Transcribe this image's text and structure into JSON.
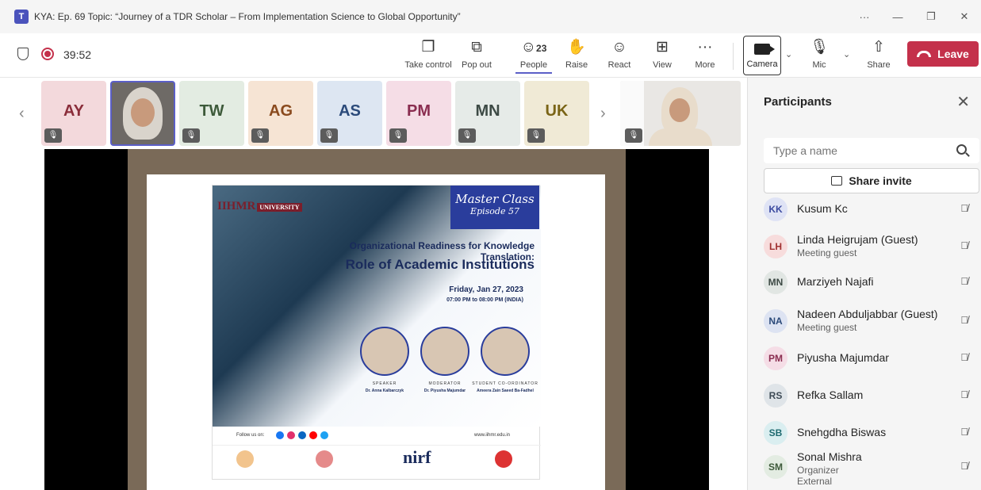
{
  "window": {
    "title": "KYA: Ep. 69 Topic: “Journey of a TDR Scholar – From Implementation Science to Global Opportunity”",
    "controls": [
      "···",
      "—",
      "❐",
      "✕"
    ]
  },
  "toolbar": {
    "timer": "39:52",
    "people_count": "23",
    "buttons": [
      {
        "label": "Take control",
        "icon": "take-control-icon",
        "glyph": "❐"
      },
      {
        "label": "Pop out",
        "icon": "pop-out-icon",
        "glyph": "⧉"
      },
      {
        "label": "People",
        "icon": "people-icon",
        "glyph": "☺"
      },
      {
        "label": "Raise",
        "icon": "raise-hand-icon",
        "glyph": "✋"
      },
      {
        "label": "React",
        "icon": "react-icon",
        "glyph": "☺"
      },
      {
        "label": "View",
        "icon": "view-icon",
        "glyph": "⊞"
      },
      {
        "label": "More",
        "icon": "more-icon",
        "glyph": "···"
      }
    ],
    "camera_label": "Camera",
    "mic_label": "Mic",
    "share_label": "Share",
    "leave_label": "Leave",
    "accent": "#5b5fc7",
    "leave_color": "#c4314b"
  },
  "video_strip": {
    "tiles": [
      {
        "initials": "AY",
        "color": "#f3d9dc",
        "text_color": "#8a2d3a"
      },
      {
        "initials": "",
        "video": true
      },
      {
        "initials": "TW",
        "color": "#e3ece2",
        "text_color": "#3d5a3a"
      },
      {
        "initials": "AG",
        "color": "#f6e4d4",
        "text_color": "#8a4a1e"
      },
      {
        "initials": "AS",
        "color": "#dde6f2",
        "text_color": "#2b4a7a"
      },
      {
        "initials": "PM",
        "color": "#f5dde6",
        "text_color": "#8a2d50"
      },
      {
        "initials": "MN",
        "color": "#e6ebe8",
        "text_color": "#3d4a45"
      },
      {
        "initials": "UK",
        "color": "#f0ead6",
        "text_color": "#7a6416"
      }
    ]
  },
  "shared_content": {
    "poster": {
      "logo": "IIHMR",
      "logo_tag": "UNIVERSITY",
      "masterclass_line1": "Master Class",
      "masterclass_line2": "Episode 57",
      "title_line1": "Organizational Readiness for Knowledge Translation:",
      "title_line2": "Role of Academic Institutions",
      "date": "Friday, Jan 27, 2023",
      "time": "07:00 PM to 08:00 PM (INDIA)",
      "speakers": [
        {
          "role": "SPEAKER",
          "name": "Dr. Anna Kalbarczyk"
        },
        {
          "role": "MODERATOR",
          "name": "Dr. Piyusha Majumdar"
        },
        {
          "role": "STUDENT CO-ORDINATOR",
          "name": "Ameera Zain Saeed Ba-Fadhel"
        }
      ],
      "follow_text": "Follow us on:",
      "url": "www.iihmr.edu.in",
      "nirf": "nirf"
    }
  },
  "panel": {
    "title": "Participants",
    "search_placeholder": "Type a name",
    "share_invite": "Share invite",
    "participants": [
      {
        "initials": "KK",
        "name": "Kusum Kc",
        "sub": "",
        "sub2": "",
        "avatar_bg": "#dfe3f5",
        "avatar_fg": "#3b4aa0"
      },
      {
        "initials": "LH",
        "name": "Linda Heigrujam (Guest)",
        "sub": "Meeting guest",
        "sub2": "",
        "avatar_bg": "#f7dcdc",
        "avatar_fg": "#a03030"
      },
      {
        "initials": "MN",
        "name": "Marziyeh Najafi",
        "sub": "",
        "sub2": "",
        "avatar_bg": "#e1e6e3",
        "avatar_fg": "#3d4a45"
      },
      {
        "initials": "NA",
        "name": "Nadeen Abduljabbar (Guest)",
        "sub": "Meeting guest",
        "sub2": "",
        "avatar_bg": "#dde3f2",
        "avatar_fg": "#2b4a7a"
      },
      {
        "initials": "PM",
        "name": "Piyusha Majumdar",
        "sub": "",
        "sub2": "",
        "avatar_bg": "#f5dde6",
        "avatar_fg": "#8a2d50"
      },
      {
        "initials": "RS",
        "name": "Refka Sallam",
        "sub": "",
        "sub2": "",
        "avatar_bg": "#dfe4e8",
        "avatar_fg": "#3d4a55"
      },
      {
        "initials": "SB",
        "name": "Snehgdha Biswas",
        "sub": "",
        "sub2": "",
        "avatar_bg": "#daeef0",
        "avatar_fg": "#1e6a70"
      },
      {
        "initials": "SM",
        "name": "Sonal Mishra",
        "sub": "Organizer",
        "sub2": "External",
        "avatar_bg": "#e3ece2",
        "avatar_fg": "#3d5a3a"
      }
    ]
  }
}
